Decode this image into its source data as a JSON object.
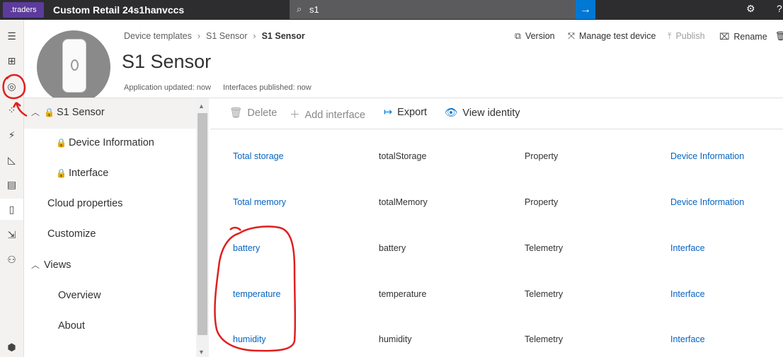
{
  "topbar": {
    "logo_text": ".traders",
    "app_title": "Custom Retail 24s1hanvccs",
    "search_value": "s1",
    "search_icon": "search-icon",
    "search_button_icon": "arrow-right-icon",
    "settings_icon": "gear-icon",
    "help_label": "?"
  },
  "rail": [
    "hamburger-icon",
    "dashboard-icon",
    "devices-icon",
    "device-groups-icon",
    "rules-icon",
    "analytics-icon",
    "jobs-icon",
    "device-templates-icon",
    "data-export-icon",
    "administration-icon",
    "iot-central-icon"
  ],
  "header": {
    "breadcrumb": [
      "Device templates",
      "S1 Sensor",
      "S1 Sensor"
    ],
    "title": "S1 Sensor",
    "app_updated": "Application updated: now",
    "interfaces_published": "Interfaces published: now"
  },
  "commands": {
    "version": "Version",
    "manage_test_device": "Manage test device",
    "publish": "Publish",
    "rename": "Rename"
  },
  "tree": {
    "root": "S1 Sensor",
    "device_information": "Device Information",
    "interface": "Interface",
    "cloud_properties": "Cloud properties",
    "customize": "Customize",
    "views": "Views",
    "overview": "Overview",
    "about": "About"
  },
  "toolbar": {
    "delete": "Delete",
    "add_interface": "Add interface",
    "export": "Export",
    "view_identity": "View identity"
  },
  "rows": [
    {
      "display_name": "Total storage",
      "name": "totalStorage",
      "capability": "Property",
      "interface": "Device Information"
    },
    {
      "display_name": "Total memory",
      "name": "totalMemory",
      "capability": "Property",
      "interface": "Device Information"
    },
    {
      "display_name": "battery",
      "name": "battery",
      "capability": "Telemetry",
      "interface": "Interface"
    },
    {
      "display_name": "temperature",
      "name": "temperature",
      "capability": "Telemetry",
      "interface": "Interface"
    },
    {
      "display_name": "humidity",
      "name": "humidity",
      "capability": "Telemetry",
      "interface": "Interface"
    }
  ],
  "colors": {
    "accent": "#0078d4",
    "link": "#0563c1",
    "annotation": "#e0201f",
    "topbar": "#2d2d30"
  }
}
